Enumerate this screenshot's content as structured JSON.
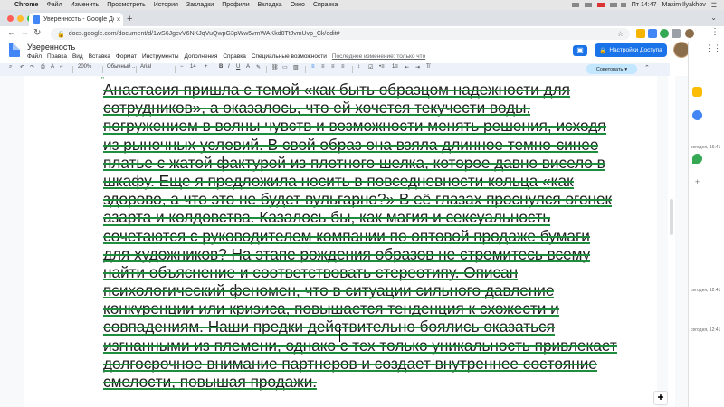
{
  "menubar": {
    "app": "Chrome",
    "items": [
      "Файл",
      "Изменить",
      "Просмотреть",
      "История",
      "Закладки",
      "Профили",
      "Вкладка",
      "Окно",
      "Справка"
    ],
    "time": "Пт 14:47",
    "user": "Maxim Ilyakhov"
  },
  "browser": {
    "tab_title": "Уверенность - Google Докум...",
    "url": "docs.google.com/document/d/1wS6JgcvV6NKJqVuQwpG3pWw5vmWAKkd8TtJvmUvp_Ck/edit#"
  },
  "doc": {
    "title": "Уверенность",
    "menus": [
      "Файл",
      "Правка",
      "Вид",
      "Вставка",
      "Формат",
      "Инструменты",
      "Дополнения",
      "Справка",
      "Специальные возможности"
    ],
    "last_edit": "Последнее изменение: только что",
    "share_label": "Настройки Доступа",
    "suggest_label": "Советовать"
  },
  "toolbar": {
    "zoom": "200%",
    "style": "Обычный ...",
    "font": "Arial",
    "size": "14"
  },
  "content": {
    "lines": [
      "Анастасия пришла с темой «как быть образцом надежности для",
      "сотрудников», а оказалось, что ей хочется текучести воды,",
      "погружением в волны чувств и возможности менять решения, исходя",
      "из рыночных условий. В свой образ она взяла длинное темно-синее",
      "платье с жатой фактурой из плотного шелка, которое давно висело в",
      "шкафу. Еще я предложила носить в повседневности кольца «как",
      "здорово, а что это не будет вульгарно?» В её глазах проснулся огонек",
      "азарта и колдовства. Казалось бы, как магия и сексуальность",
      "сочетаются с руководителем компании  по оптовой продаже бумаги",
      "для художников? На этапе рождения образов не стремитесь всему",
      "найти объяснение и соответствовать стереотипу. Описан",
      "психологический феномен, что в ситуации сильного давление",
      "конкуренции или кризиса, повышается тенденция к схожести и",
      "совпадениям. Наши предки действительно боялись оказаться",
      "изгнанными из племени, однако с тех только уникальность привлекает",
      "долгосрочное внимание партнеров и создает внутреннее состояние",
      "смелости, повышая продажи."
    ]
  },
  "sidepanel": {
    "times": [
      "сегодня, 16:41",
      "сегодня, 12:41",
      "сегодня, 12:41"
    ]
  },
  "colors": {
    "suggestion_green": "#1e8e3e",
    "share_blue": "#1a73e8"
  }
}
